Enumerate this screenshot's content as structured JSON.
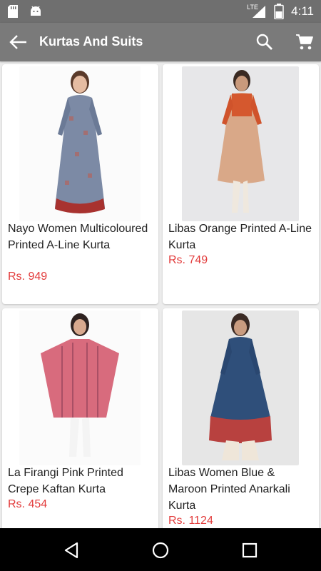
{
  "status_bar": {
    "time": "4:11",
    "network": "LTE",
    "icons": [
      "sd-card-icon",
      "android-icon",
      "signal-icon",
      "battery-icon"
    ]
  },
  "app_bar": {
    "title": "Kurtas And Suits",
    "icons": [
      "back-arrow-icon",
      "search-icon",
      "cart-icon"
    ]
  },
  "products": [
    {
      "name": "Nayo Women Multicoloured Printed A-Line Kurta",
      "price": "Rs. 949"
    },
    {
      "name": "Libas Orange Printed A-Line Kurta",
      "price": "Rs. 749"
    },
    {
      "name": "La Firangi Pink Printed Crepe Kaftan Kurta",
      "price": "Rs. 454"
    },
    {
      "name": "Libas Women Blue & Maroon Printed Anarkali Kurta",
      "price": "Rs. 1124"
    }
  ],
  "nav_bar": {
    "icons": [
      "back-nav-icon",
      "home-nav-icon",
      "recents-nav-icon"
    ]
  },
  "colors": {
    "status_bar": "#6f6f6f",
    "app_bar": "#7a7a7a",
    "price": "#e23b3b",
    "background": "#ececec"
  }
}
